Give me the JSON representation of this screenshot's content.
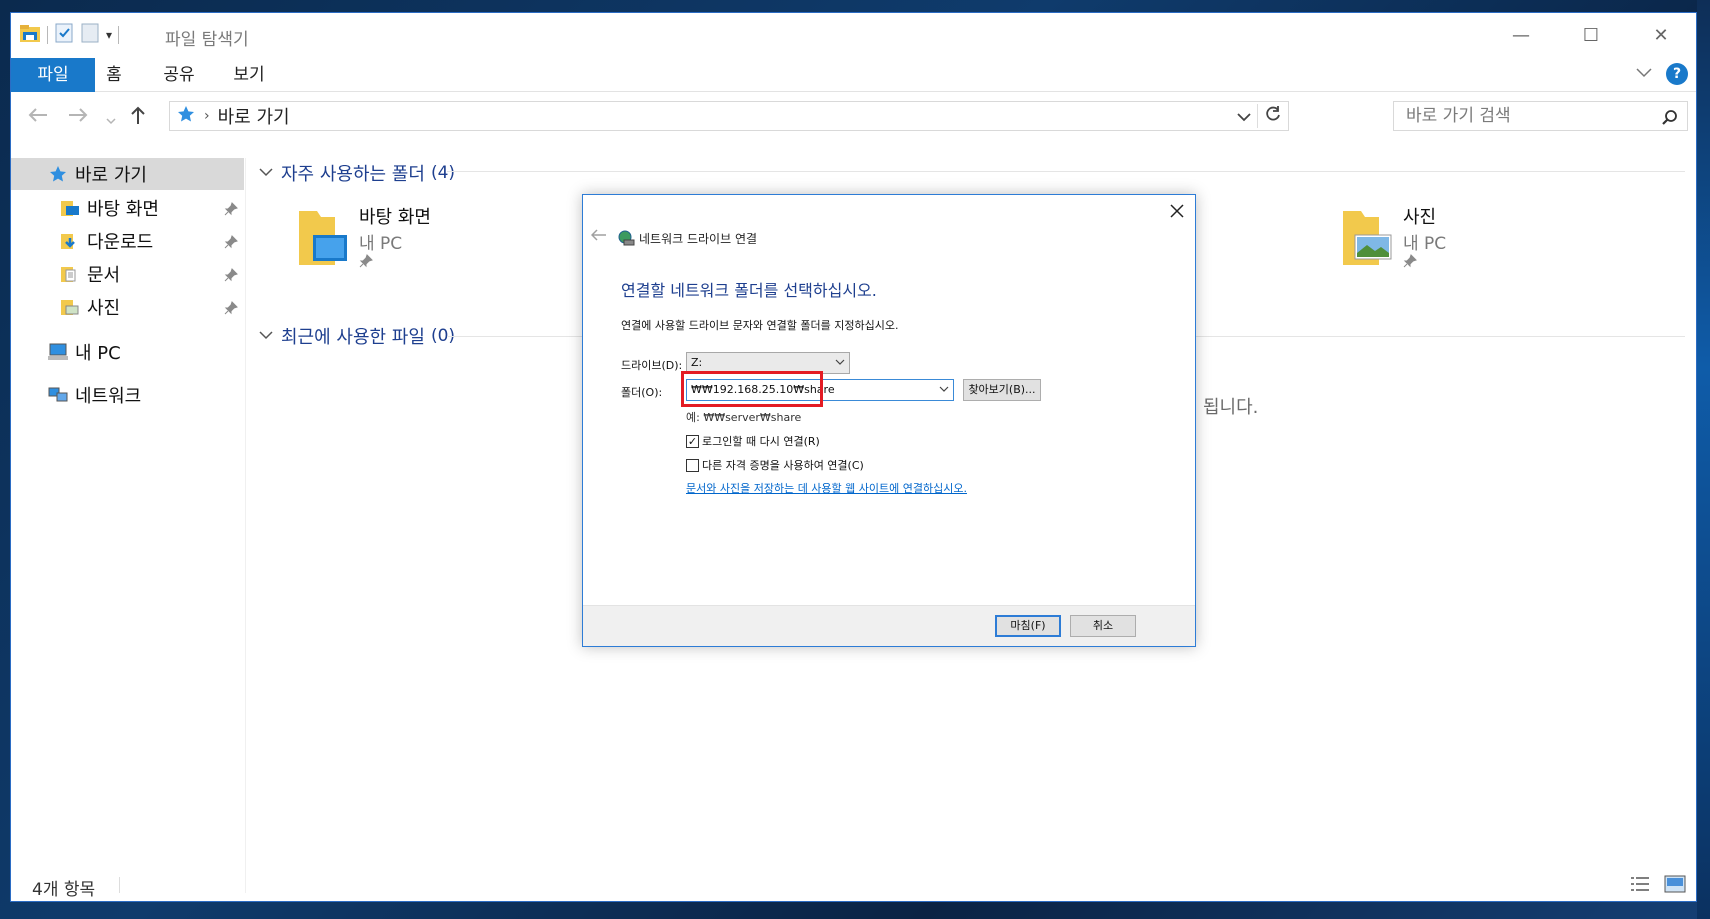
{
  "window": {
    "title": "파일 탐색기",
    "controls": {
      "minimize": "—",
      "maximize": "☐",
      "close": "✕"
    }
  },
  "ribbon": {
    "tabs": [
      "파일",
      "홈",
      "공유",
      "보기"
    ],
    "help": "?"
  },
  "address": {
    "crumb": "바로 가기",
    "search_placeholder": "바로 가기 검색"
  },
  "sidebar": {
    "quick_access": "바로 가기",
    "pinned": [
      "바탕 화면",
      "다운로드",
      "문서",
      "사진"
    ],
    "this_pc": "내 PC",
    "network": "네트워크"
  },
  "main": {
    "frequent_header": "자주 사용하는 폴더",
    "frequent_count": "(4)",
    "recent_header": "최근에 사용한 파일",
    "recent_count": "(0)",
    "folders": [
      {
        "name": "바탕 화면",
        "location": "내 PC"
      },
      {
        "name": "사진",
        "location": "내 PC"
      }
    ],
    "partial_text": "됩니다."
  },
  "status": {
    "count": "4개 항목"
  },
  "dialog": {
    "title": "네트워크 드라이브 연결",
    "heading": "연결할 네트워크 폴더를 선택하십시오.",
    "description": "연결에 사용할 드라이브 문자와 연결할 폴더를 지정하십시오.",
    "drive_label": "드라이브(D):",
    "drive_value": "Z:",
    "folder_label": "폴더(O):",
    "folder_value": "₩₩192.168.25.10₩share",
    "browse_label": "찾아보기(B)...",
    "example": "예: ₩₩server₩share",
    "reconnect_label": "로그인할 때 다시 연결(R)",
    "reconnect_checked": true,
    "credentials_label": "다른 자격 증명을 사용하여 연결(C)",
    "credentials_checked": false,
    "link": "문서와 사진을 저장하는 데 사용할 웹 사이트에 연결하십시오.",
    "finish_label": "마침(F)",
    "cancel_label": "취소"
  },
  "colors": {
    "accent": "#1979ca",
    "heading_blue": "#1e3f8f",
    "highlight_red": "#e31b23"
  }
}
